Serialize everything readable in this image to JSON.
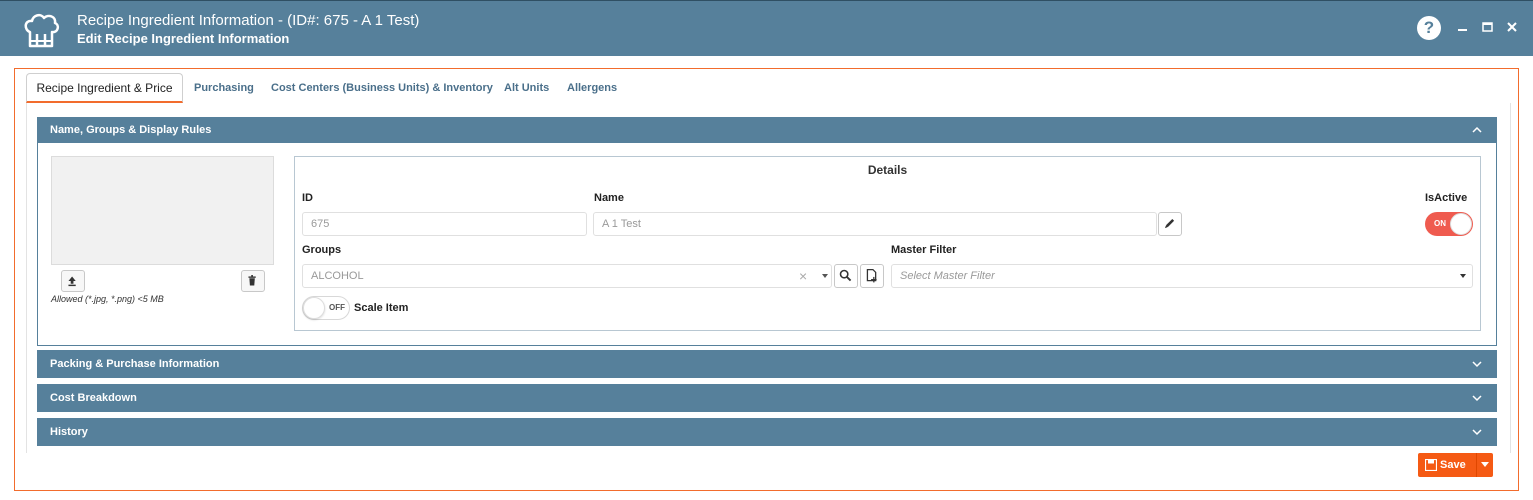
{
  "window": {
    "title": "Recipe Ingredient Information - (ID#: 675 - A 1 Test)",
    "subtitle": "Edit Recipe Ingredient Information",
    "logo_icon": "chef-hat-icon",
    "help_label": "?"
  },
  "tabs": [
    {
      "label": "Recipe Ingredient & Price",
      "active": true
    },
    {
      "label": "Purchasing",
      "active": false
    },
    {
      "label": "Cost Centers (Business Units) & Inventory",
      "active": false
    },
    {
      "label": "Alt Units",
      "active": false
    },
    {
      "label": "Allergens",
      "active": false
    }
  ],
  "sections": {
    "name_groups": {
      "label": "Name, Groups & Display Rules",
      "expanded": true
    },
    "packing": {
      "label": "Packing & Purchase Information",
      "expanded": false
    },
    "cost": {
      "label": "Cost Breakdown",
      "expanded": false
    },
    "history": {
      "label": "History",
      "expanded": false
    }
  },
  "image_panel": {
    "allowed_text": "Allowed (*.jpg, *.png) <5 MB"
  },
  "details": {
    "title": "Details",
    "id_label": "ID",
    "id_value": "675",
    "name_label": "Name",
    "name_value": "A 1 Test",
    "isactive_label": "IsActive",
    "isactive_state": "ON",
    "groups_label": "Groups",
    "groups_value": "ALCOHOL",
    "clear_glyph": "×",
    "master_filter_label": "Master Filter",
    "master_filter_placeholder": "Select Master Filter",
    "scale_state": "OFF",
    "scale_label": "Scale Item"
  },
  "footer": {
    "save_label": "Save"
  },
  "colors": {
    "header": "#56809b",
    "accent": "#f26c2d",
    "save": "#f55a14",
    "toggle_on": "#ef5b4f"
  }
}
